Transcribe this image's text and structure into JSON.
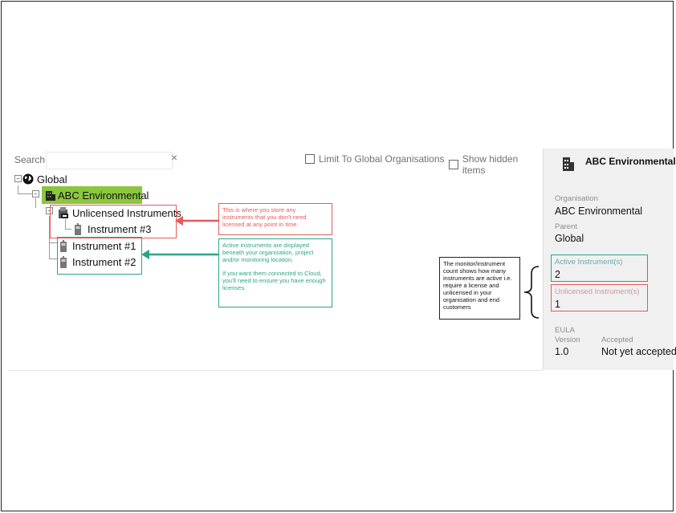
{
  "search": {
    "label": "Search",
    "value": "",
    "clear": "×"
  },
  "filters": {
    "limit_global": "Limit To Global Organisations",
    "show_hidden": "Show hidden items"
  },
  "tree": {
    "global": "Global",
    "abc": "ABC Environmental",
    "unlicensed": "Unlicensed Instruments",
    "inst3": "Instrument #3",
    "inst1": "Instrument #1",
    "inst2": "Instrument #2"
  },
  "annotations": {
    "red": "This is where you store any instruments that you don't need licensed at any point in time.",
    "green_1": "Active instruments are displayed beneath your organisation, project and/or monitoring location.",
    "green_2": "If you want them connected to Cloud, you'll need to ensure you have enough licenses.",
    "black": "The monitor/instrument count shows how many instruments are active i.e. require a license and unlicensed in your organisation and end customers"
  },
  "panel": {
    "title": "ABC Environmental",
    "org_label": "Organisation",
    "org_value": "ABC Environmental",
    "parent_label": "Parent",
    "parent_value": "Global",
    "active_label": "Active Instrument(s)",
    "active_value": "2",
    "unlicensed_label": "Unlicensed Instrument(s)",
    "unlicensed_value": "1",
    "eula_label": "EULA",
    "version_label": "Version",
    "version_value": "1.0",
    "accepted_label": "Accepted",
    "accepted_value": "Not yet accepted"
  },
  "colors": {
    "selection": "#8cc63f",
    "red": "#e45b5b",
    "green": "#2aa48a"
  }
}
